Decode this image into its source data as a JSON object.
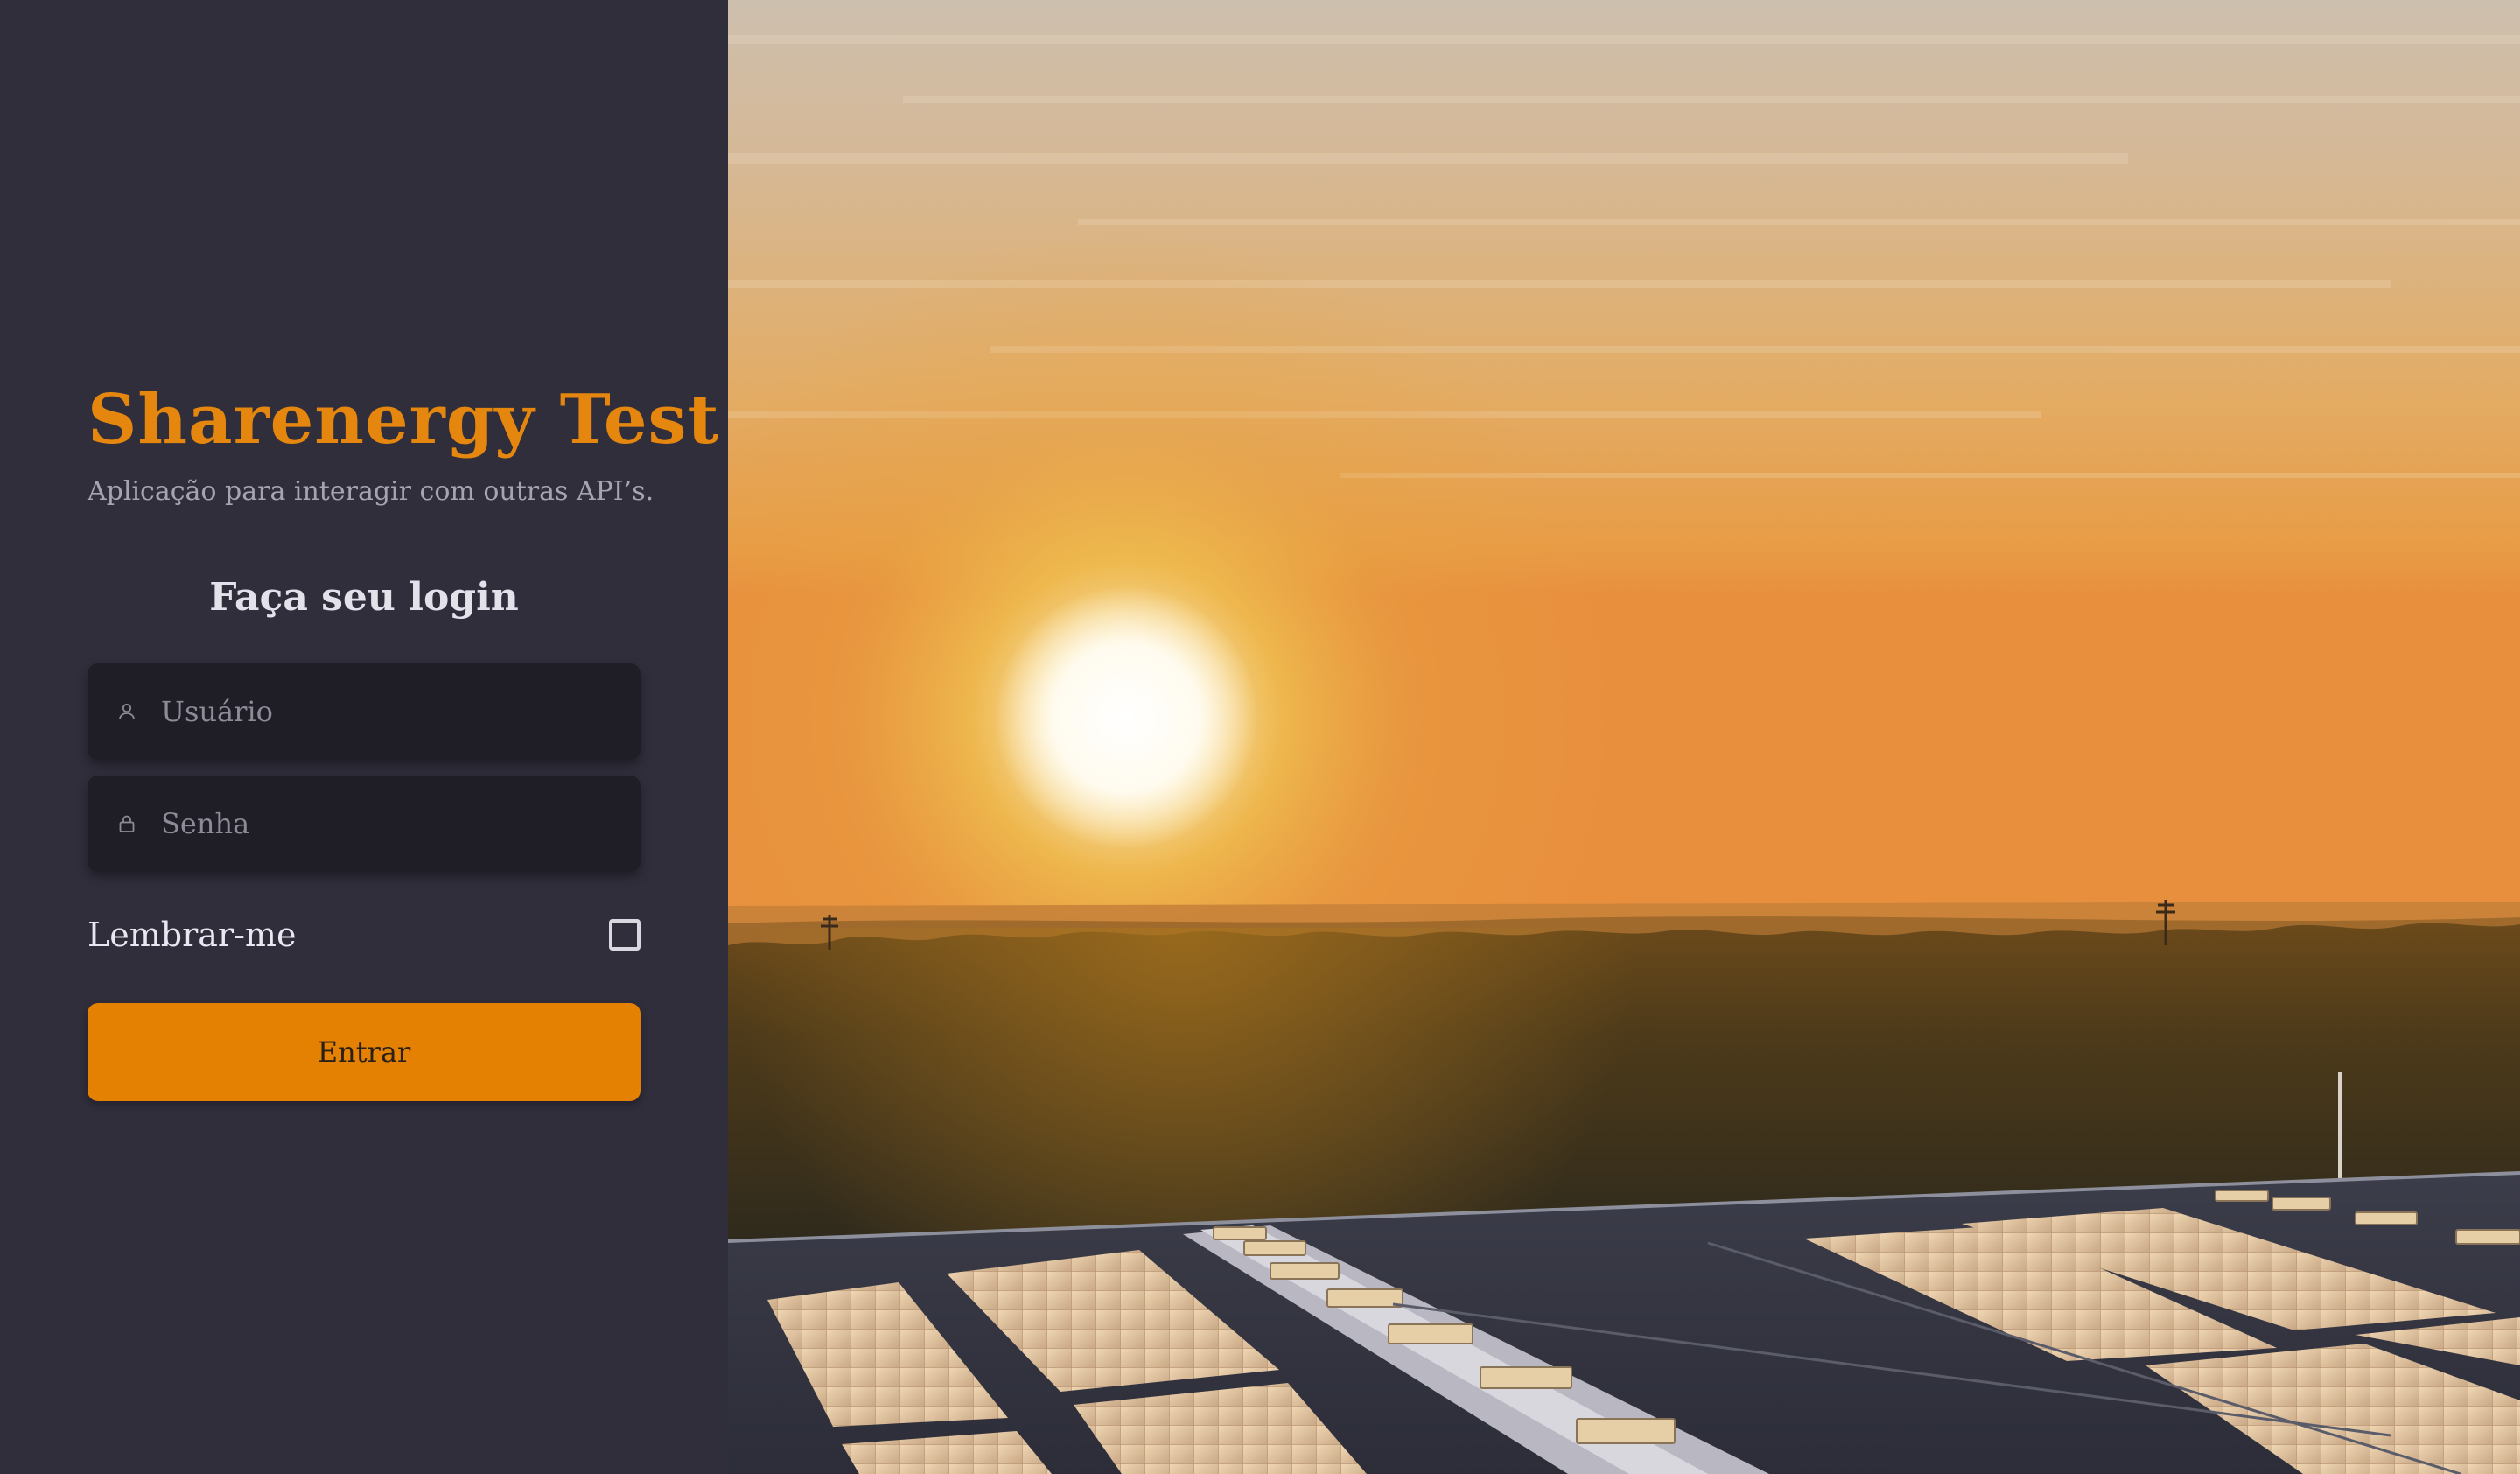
{
  "brand": {
    "title": "Sharenergy Test",
    "subtitle": "Aplicação para interagir com outras API’s."
  },
  "login": {
    "heading": "Faça seu login",
    "username": {
      "placeholder": "Usuário",
      "value": "",
      "icon": "user-icon"
    },
    "password": {
      "placeholder": "Senha",
      "value": "",
      "icon": "lock-icon"
    },
    "remember_label": "Lembrar-me",
    "remember_checked": false,
    "submit_label": "Entrar"
  },
  "hero": {
    "image": "sunset-over-forest-with-solar-panel-rooftop"
  },
  "colors": {
    "accent": "#e48103",
    "panel_bg": "#302e3b",
    "input_bg": "#1f1e26"
  }
}
